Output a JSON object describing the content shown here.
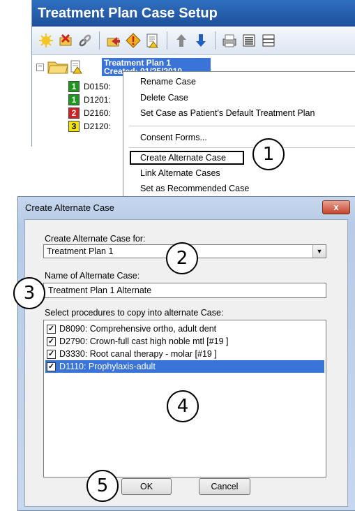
{
  "panel": {
    "title": "Treatment Plan Case Setup",
    "toolbar_icons": [
      "new-case-icon",
      "delete-case-icon",
      "link-icon",
      "move-icon",
      "diamond-icon",
      "consent-doc-icon",
      "up-arrow-icon",
      "down-arrow-icon",
      "print-icon",
      "list-icon",
      "collapse-icon"
    ],
    "tree": {
      "case_label_line1": "Treatment Plan 1",
      "case_label_line2": "Created: 01/25/2010",
      "procedures": [
        {
          "num": "1",
          "color": "#1a9a1a",
          "code": "D0150:"
        },
        {
          "num": "1",
          "color": "#1a9a1a",
          "code": "D1201:"
        },
        {
          "num": "2",
          "color": "#d81e1e",
          "code": "D2160:"
        },
        {
          "num": "3",
          "color": "#f2e400",
          "code": "D2120:"
        }
      ]
    }
  },
  "context_menu": {
    "items": [
      "Rename Case",
      "Delete Case",
      "Set Case as Patient's Default Treatment Plan",
      "Consent Forms...",
      "Create Alternate Case",
      "Link Alternate Cases",
      "Set as Recommended Case"
    ]
  },
  "callouts": [
    "1",
    "2",
    "3",
    "4",
    "5"
  ],
  "dialog": {
    "title": "Create Alternate Case",
    "close_label": "x",
    "create_for_label": "Create Alternate Case for:",
    "create_for_value": "Treatment Plan 1",
    "name_label": "Name of Alternate Case:",
    "name_value": "Treatment Plan 1 Alternate",
    "select_label": "Select procedures to copy into alternate Case:",
    "procedures": [
      "D8090: Comprehensive ortho, adult dent",
      "D2790: Crown-full cast high noble mtl [#19 ]",
      "D3330: Root canal therapy - molar [#19 ]",
      "D1110: Prophylaxis-adult"
    ],
    "ok_label": "OK",
    "cancel_label": "Cancel"
  }
}
